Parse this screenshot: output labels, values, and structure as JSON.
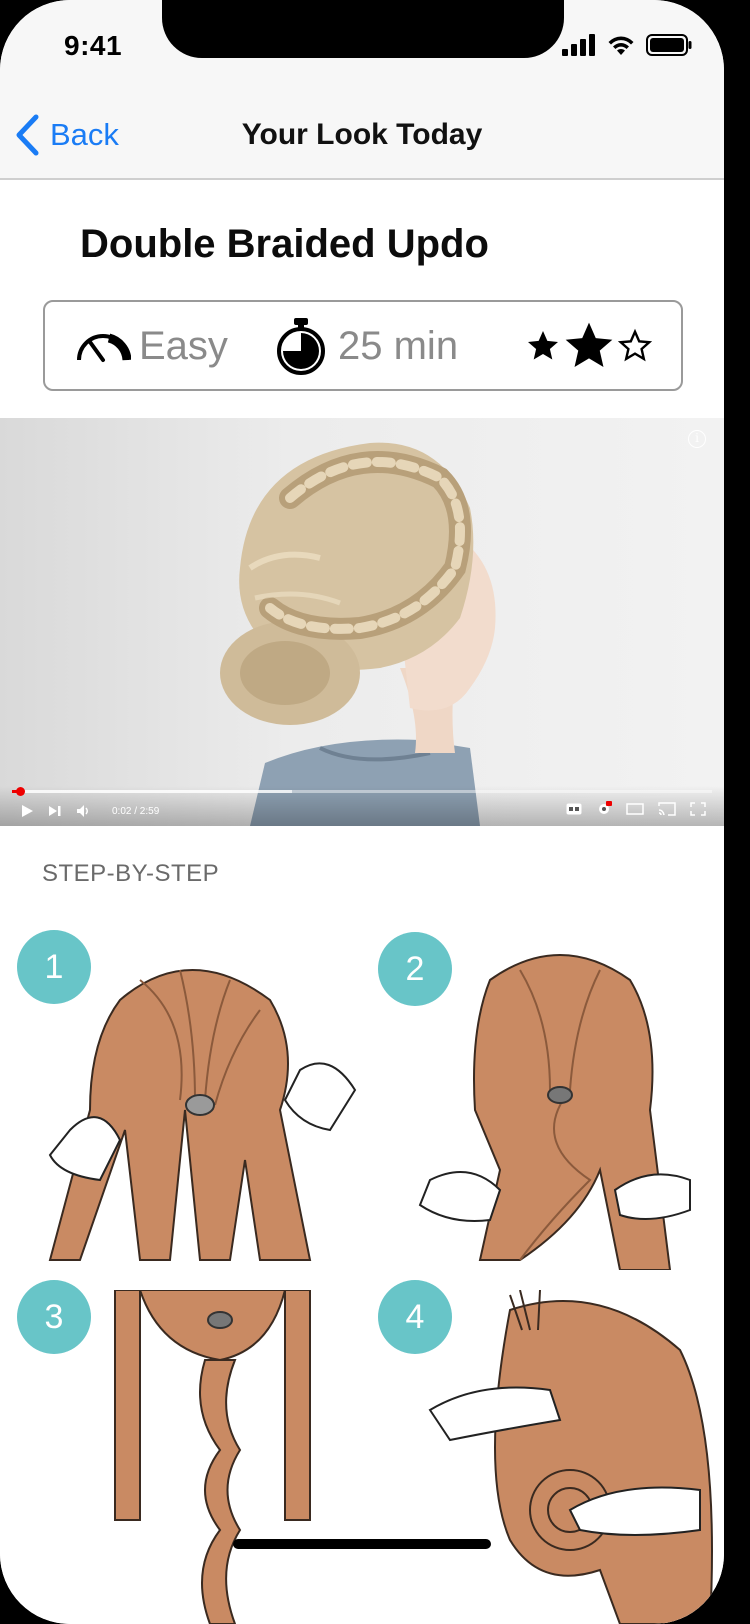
{
  "status_bar": {
    "time": "9:41"
  },
  "nav": {
    "back_label": "Back",
    "title": "Your Look Today"
  },
  "look": {
    "title": "Double Braided Updo",
    "difficulty": "Easy",
    "duration": "25 min",
    "rating": {
      "filled": 2,
      "total": 3
    }
  },
  "video": {
    "current_time": "0:02 / 2:59",
    "progress": 0.011,
    "buffered": 0.4,
    "info_glyph": "i"
  },
  "steps": {
    "heading": "STEP-BY-STEP",
    "items": [
      {
        "number": "1"
      },
      {
        "number": "2"
      },
      {
        "number": "3"
      },
      {
        "number": "4"
      }
    ]
  },
  "colors": {
    "accent": "#1a7cf5",
    "step_badge": "#68c5c8",
    "hair": "#c98a63",
    "video_progress": "#ee0000"
  },
  "icons": {
    "back": "chevron-left-icon",
    "difficulty": "speedometer-icon",
    "duration": "stopwatch-icon",
    "rating": "star-icon"
  }
}
